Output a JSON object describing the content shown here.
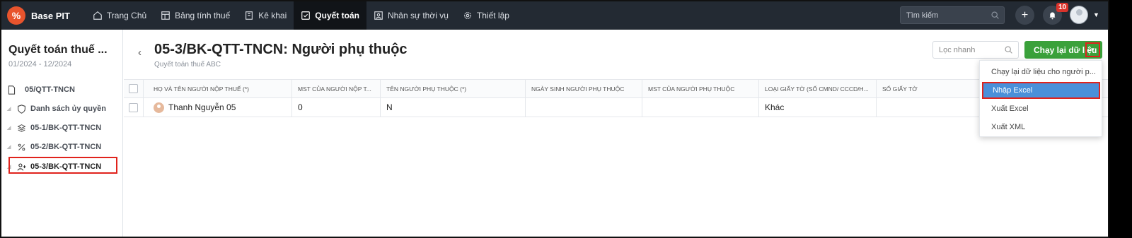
{
  "app": {
    "name": "Base PIT",
    "logo_glyph": "%"
  },
  "nav": [
    {
      "label": "Trang Chủ",
      "icon": "home-icon"
    },
    {
      "label": "Bảng tính thuế",
      "icon": "table-icon"
    },
    {
      "label": "Kê khai",
      "icon": "book-icon"
    },
    {
      "label": "Quyết toán",
      "icon": "checklist-icon",
      "active": true
    },
    {
      "label": "Nhân sự thời vụ",
      "icon": "person-icon"
    },
    {
      "label": "Thiết lập",
      "icon": "gear-icon"
    }
  ],
  "topbar": {
    "search_placeholder": "Tìm kiếm",
    "notification_count": "10",
    "add_glyph": "+"
  },
  "sidebar": {
    "title": "Quyết toán thuế ...",
    "period": "01/2024 - 12/2024",
    "items": [
      {
        "label": "05/QTT-TNCN",
        "icon": "file-icon"
      },
      {
        "label": "Danh sách ủy quyền",
        "icon": "shield-icon"
      },
      {
        "label": "05-1/BK-QTT-TNCN",
        "icon": "layers-icon"
      },
      {
        "label": "05-2/BK-QTT-TNCN",
        "icon": "percent-icon"
      },
      {
        "label": "05-3/BK-QTT-TNCN",
        "icon": "user-plus-icon",
        "active": true
      }
    ]
  },
  "header": {
    "title": "05-3/BK-QTT-TNCN: Người phụ thuộc",
    "subtitle": "Quyết toán thuế ABC",
    "quick_filter_placeholder": "Lọc nhanh",
    "run_button": "Chạy lại dữ liệu"
  },
  "table": {
    "columns": [
      "HỌ VÀ TÊN NGƯỜI NỘP THUẾ (*)",
      "MST CỦA NGƯỜI NỘP T...",
      "TÊN NGƯỜI PHỤ THUỘC (*)",
      "NGÀY SINH NGƯỜI PHỤ THUỘC",
      "MST CỦA NGƯỜI PHỤ THUỘC",
      "LOẠI GIẤY TỜ (SỐ CMND/ CCCD/H...",
      "SỐ GIẤY TỜ",
      "S"
    ],
    "rows": [
      [
        "Thanh Nguyễn 05",
        "0",
        "N",
        "",
        "",
        "Khác",
        "",
        ""
      ]
    ]
  },
  "dropdown": {
    "items": [
      "Chạy lại dữ liệu cho người p...",
      "Nhập Excel",
      "Xuất Excel",
      "Xuất XML"
    ],
    "selected_index": 1
  },
  "colors": {
    "topbar": "#232a33",
    "accent_green": "#3aa13a",
    "highlight_red": "#e0231c",
    "selected_blue": "#4a90d9",
    "logo": "#e8542d"
  }
}
